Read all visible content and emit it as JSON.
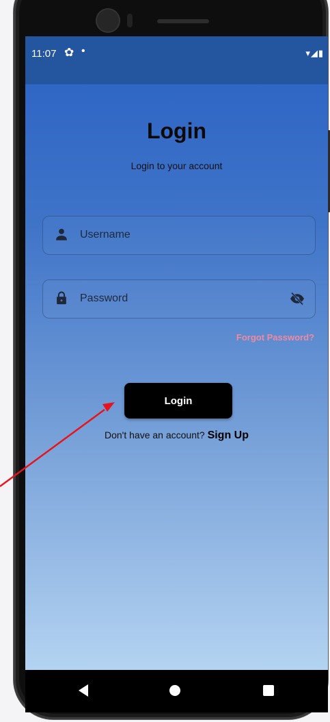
{
  "status_bar": {
    "time": "11:07",
    "settings_icon": "gear-icon",
    "notification_dot": "•",
    "system_icons": "▾◢▮"
  },
  "login": {
    "title": "Login",
    "subtitle": "Login to your account",
    "username_placeholder": "Username",
    "password_placeholder": "Password",
    "forgot_password": "Forgot Password?",
    "login_button": "Login",
    "signup_prompt": "Don't have an account?",
    "signup_link": "Sign Up"
  },
  "colors": {
    "accent_link": "#f08aa0",
    "button": "#000000",
    "annotation_arrow": "#e8141c"
  },
  "icons": {
    "username": "person-icon",
    "password": "lock-icon",
    "visibility": "eye-off-icon"
  }
}
